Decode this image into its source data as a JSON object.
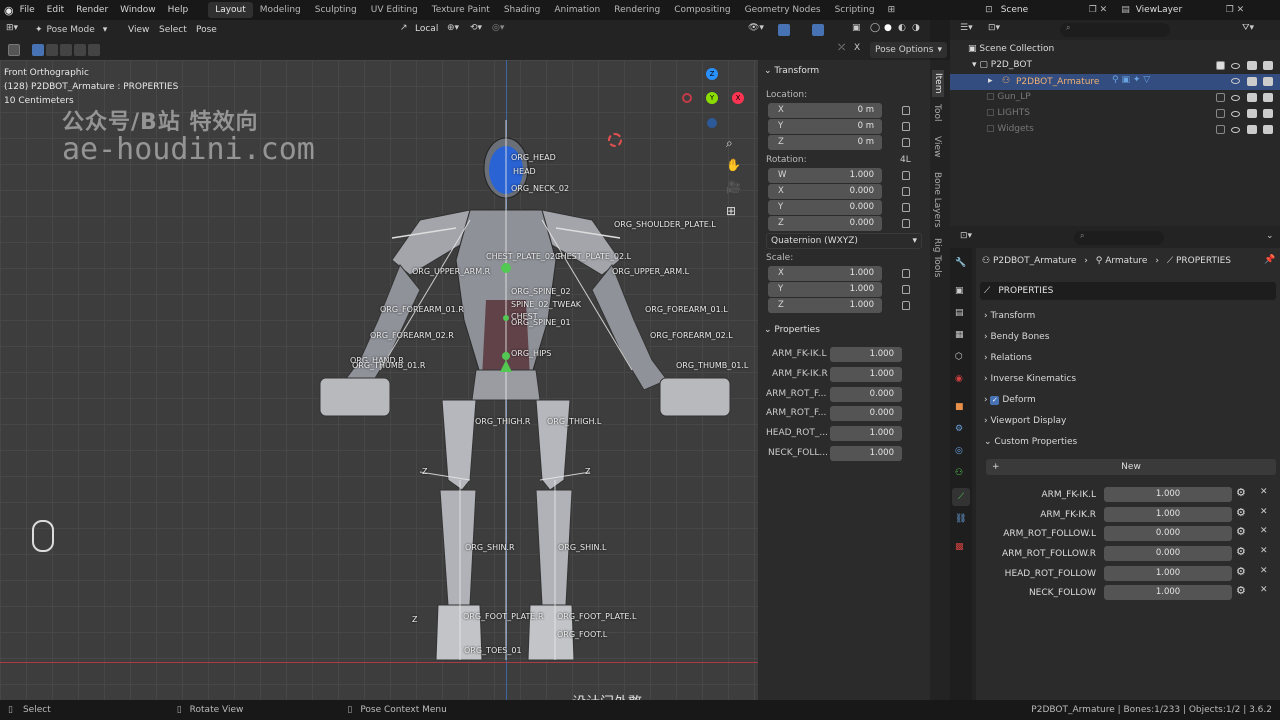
{
  "topbar": {
    "menus": [
      "File",
      "Edit",
      "Render",
      "Window",
      "Help"
    ],
    "workspaces": [
      "Layout",
      "Modeling",
      "Sculpting",
      "UV Editing",
      "Texture Paint",
      "Shading",
      "Animation",
      "Rendering",
      "Compositing",
      "Geometry Nodes",
      "Scripting"
    ],
    "scene": "Scene",
    "view_layer": "ViewLayer"
  },
  "viewport_header": {
    "mode": "Pose Mode",
    "menus": [
      "View",
      "Select",
      "Pose"
    ],
    "orientation": "Local",
    "pose_options": "Pose Options"
  },
  "overlay": {
    "view_name": "Front Orthographic",
    "object_info": "(128) P2DBOT_Armature : PROPERTIES",
    "scale": "10 Centimeters"
  },
  "watermark": {
    "line1": "公众号/B站  特效向",
    "line2": "ae-houdini.com",
    "bottom": "设计门外憨"
  },
  "bones": [
    {
      "name": "ORG_HEAD"
    },
    {
      "name": "HEAD"
    },
    {
      "name": "ORG_NECK_02"
    },
    {
      "name": "ORG_SHOULDER_PLATE.L"
    },
    {
      "name": "ORG_SPINE_02"
    },
    {
      "name": "SPINE_02_TWEAK"
    },
    {
      "name": "CHEST"
    },
    {
      "name": "ORG_SPINE_01"
    },
    {
      "name": "ORG_HIPS"
    },
    {
      "name": "ORG_FOREARM_01.R"
    },
    {
      "name": "ORG_FOREARM_01.L"
    },
    {
      "name": "ORG_FOREARM_02.R"
    },
    {
      "name": "ORG_FOREARM_02.L"
    },
    {
      "name": "ORG_THUMB_01.R"
    },
    {
      "name": "ORG_THUMB_01.L"
    },
    {
      "name": "ORG_HAND.R"
    },
    {
      "name": "ORG_THIGH.R"
    },
    {
      "name": "ORG_THIGH.L"
    },
    {
      "name": "ORG_SHIN.R"
    },
    {
      "name": "ORG_SHIN.L"
    },
    {
      "name": "ORG_FOOT_PLATE.R"
    },
    {
      "name": "ORG_FOOT_PLATE.L"
    },
    {
      "name": "ORG_FOOT.L"
    },
    {
      "name": "ORG_TOES_01"
    },
    {
      "name": "CHEST_PLATE_02.R"
    },
    {
      "name": "CHEST_PLATE_02.L"
    },
    {
      "name": "ORG_UPPER_ARM.L"
    },
    {
      "name": "ORG_UPPER_ARM.R"
    }
  ],
  "axis_letter": "Z",
  "transform": {
    "title": "Transform",
    "location_label": "Location:",
    "location": [
      {
        "axis": "X",
        "value": "0 m"
      },
      {
        "axis": "Y",
        "value": "0 m"
      },
      {
        "axis": "Z",
        "value": "0 m"
      }
    ],
    "rotation_label": "Rotation:",
    "rotation_mode_short": "4L",
    "rotation": [
      {
        "axis": "W",
        "value": "1.000"
      },
      {
        "axis": "X",
        "value": "0.000"
      },
      {
        "axis": "Y",
        "value": "0.000"
      },
      {
        "axis": "Z",
        "value": "0.000"
      }
    ],
    "rotation_mode": "Quaternion (WXYZ)",
    "scale_label": "Scale:",
    "scale": [
      {
        "axis": "X",
        "value": "1.000"
      },
      {
        "axis": "Y",
        "value": "1.000"
      },
      {
        "axis": "Z",
        "value": "1.000"
      }
    ]
  },
  "npanel_props": {
    "title": "Properties",
    "rows": [
      {
        "label": "ARM_FK-IK.L",
        "value": "1.000"
      },
      {
        "label": "ARM_FK-IK.R",
        "value": "1.000"
      },
      {
        "label": "ARM_ROT_F...",
        "value": "0.000"
      },
      {
        "label": "ARM_ROT_F...",
        "value": "0.000"
      },
      {
        "label": "HEAD_ROT_...",
        "value": "1.000"
      },
      {
        "label": "NECK_FOLL...",
        "value": "1.000"
      }
    ]
  },
  "ntabs": [
    "Item",
    "Tool",
    "View",
    "Bone Layers",
    "Rig Tools"
  ],
  "outliner": {
    "root": "Scene Collection",
    "items": [
      {
        "name": "P2D_BOT",
        "dim": false
      },
      {
        "name": "P2DBOT_Armature",
        "dim": false,
        "selected": true
      },
      {
        "name": "Gun_LP",
        "dim": true
      },
      {
        "name": "LIGHTS",
        "dim": true
      },
      {
        "name": "Widgets",
        "dim": true
      }
    ]
  },
  "properties": {
    "breadcrumb": [
      "P2DBOT_Armature",
      "Armature",
      "PROPERTIES"
    ],
    "bone_name": "PROPERTIES",
    "sections": [
      "Transform",
      "Bendy Bones",
      "Relations",
      "Inverse Kinematics",
      "Deform",
      "Viewport Display",
      "Custom Properties"
    ],
    "new_button": "New",
    "custom": [
      {
        "label": "ARM_FK-IK.L",
        "value": "1.000"
      },
      {
        "label": "ARM_FK-IK.R",
        "value": "1.000"
      },
      {
        "label": "ARM_ROT_FOLLOW.L",
        "value": "0.000"
      },
      {
        "label": "ARM_ROT_FOLLOW.R",
        "value": "0.000"
      },
      {
        "label": "HEAD_ROT_FOLLOW",
        "value": "1.000"
      },
      {
        "label": "NECK_FOLLOW",
        "value": "1.000"
      }
    ]
  },
  "statusbar": {
    "left": "Select",
    "mid": "Rotate View",
    "ctx": "Pose Context Menu",
    "right": "P2DBOT_Armature | Bones:1/233 | Objects:1/2 | 3.6.2"
  },
  "colors": {
    "accent": "#4772b3",
    "selected_row": "#334d80",
    "x_axis": "#ff3352",
    "y_axis": "#8bdc00",
    "z_axis": "#2890ff",
    "bone_green": "#53c853"
  }
}
